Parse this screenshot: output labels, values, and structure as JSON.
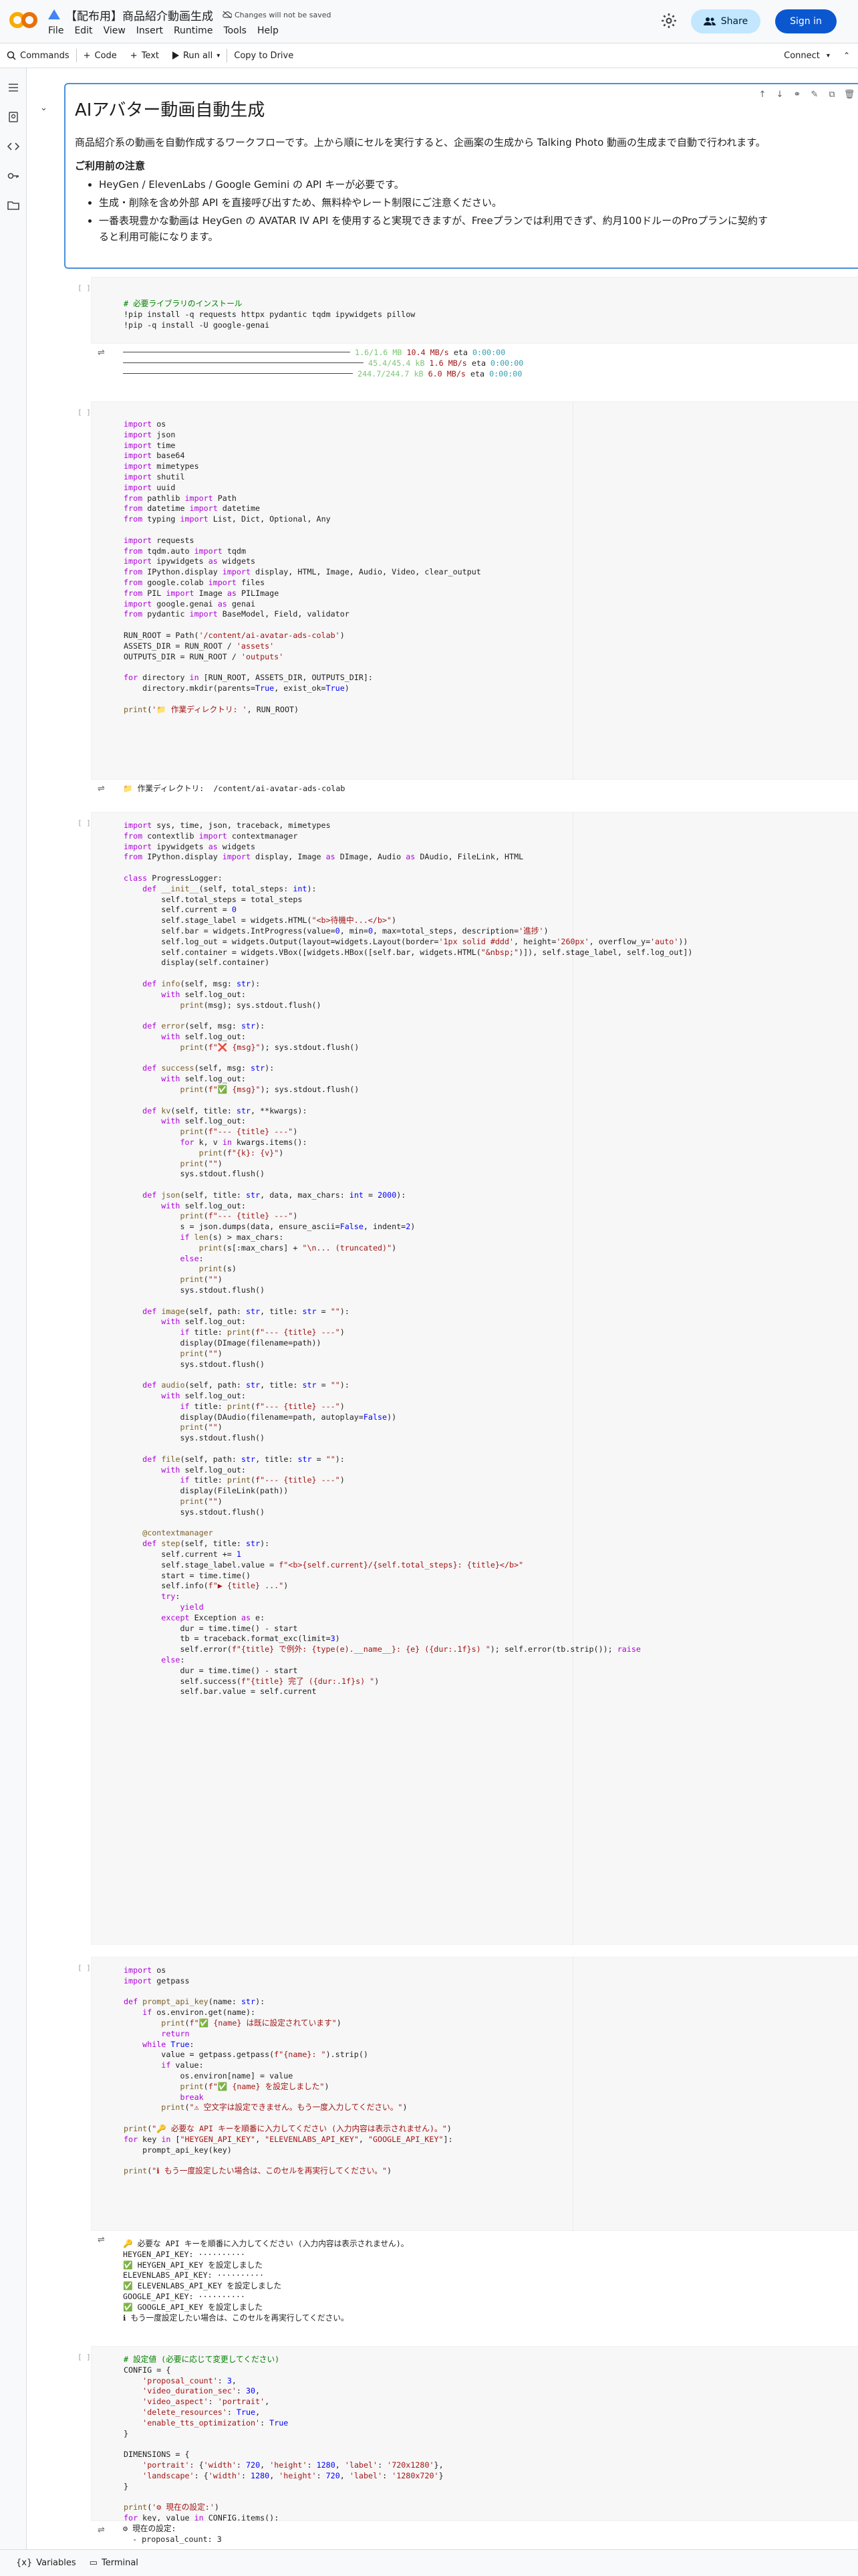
{
  "header": {
    "notebook_title": "【配布用】商品紹介動画生成",
    "unsaved_text": "Changes will not be saved",
    "menu": [
      "File",
      "Edit",
      "View",
      "Insert",
      "Runtime",
      "Tools",
      "Help"
    ],
    "share_label": "Share",
    "signin_label": "Sign in"
  },
  "toolbar": {
    "commands": "Commands",
    "code": "Code",
    "text": "Text",
    "run_all": "Run all",
    "copy_to_drive": "Copy to Drive",
    "connect": "Connect"
  },
  "markdown": {
    "heading": "AIアバター動画自動生成",
    "intro": "商品紹介系の動画を自動作成するワークフローです。上から順にセルを実行すると、企画案の生成から Talking Photo 動画の生成まで自動で行われます。",
    "notes_title": "ご利用前の注意",
    "notes": [
      "HeyGen / ElevenLabs / Google Gemini の API キーが必要です。",
      "生成・削除を含め外部 API を直接呼び出すため、無料枠やレート制限にご注意ください。",
      "一番表現豊かな動画は HeyGen の AVATAR IV API を使用すると実現できますが、Freeプランでは利用できず、約月100ドルーのProプランに契約すると利用可能になります。"
    ]
  },
  "cell_run_label": "[ ]",
  "footer": {
    "variables": "Variables",
    "terminal": "Terminal"
  },
  "colors": {
    "accent": "#0b57d0",
    "share_bg": "#c2e7ff",
    "selected_border": "#4a90d9"
  }
}
